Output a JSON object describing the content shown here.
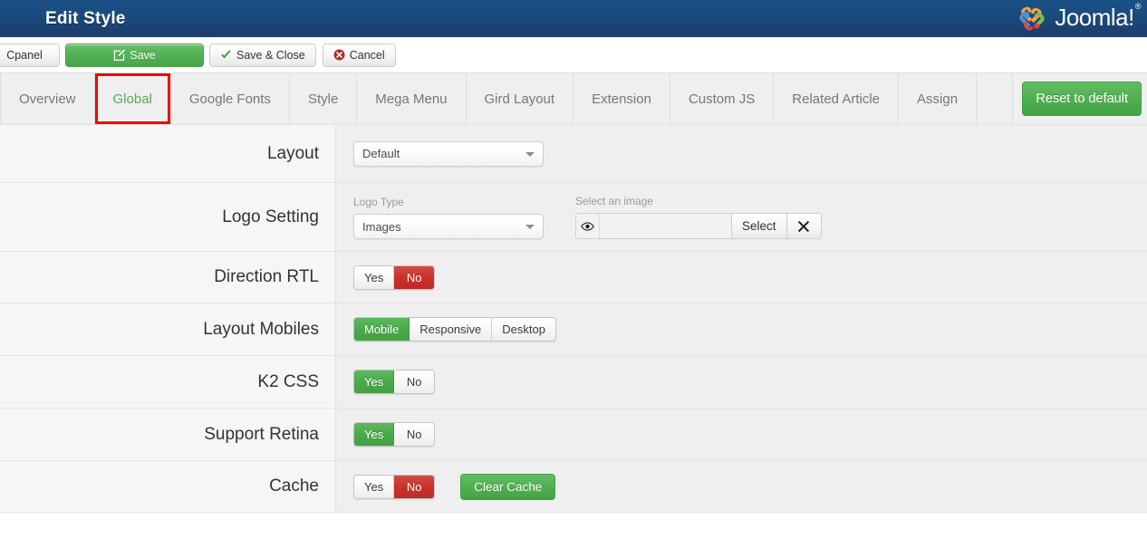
{
  "header": {
    "title": "Edit Style",
    "brand_name": "Joomla!",
    "brand_reg": "®",
    "brand_icon": "joomla-logo-icon"
  },
  "toolbar": {
    "cpanel_label": "Cpanel",
    "save_label": "Save",
    "save_icon": "pencil-icon",
    "save_close_label": "Save & Close",
    "save_close_icon": "check-icon",
    "cancel_label": "Cancel",
    "cancel_icon": "cancel-circle-icon"
  },
  "tabs": {
    "items": [
      {
        "label": "Overview",
        "active": false
      },
      {
        "label": "Global",
        "active": true
      },
      {
        "label": "Google Fonts",
        "active": false
      },
      {
        "label": "Style",
        "active": false
      },
      {
        "label": "Mega Menu",
        "active": false
      },
      {
        "label": "Gird Layout",
        "active": false
      },
      {
        "label": "Extension",
        "active": false
      },
      {
        "label": "Custom JS",
        "active": false
      },
      {
        "label": "Related Article",
        "active": false
      },
      {
        "label": "Assign",
        "active": false
      }
    ],
    "reset_label": "Reset to default",
    "active_highlight_color": "#f60000",
    "active_text_color": "#5aa95a"
  },
  "form": {
    "layout": {
      "label": "Layout",
      "select_value": "Default"
    },
    "logo_setting": {
      "label": "Logo Setting",
      "logo_type_label": "Logo Type",
      "logo_type_value": "Images",
      "select_image_label": "Select an image",
      "image_value": "",
      "image_placeholder": "",
      "eye_icon": "eye-icon",
      "select_button_label": "Select",
      "clear_icon": "close-x-icon"
    },
    "direction_rtl": {
      "label": "Direction RTL",
      "options": [
        "Yes",
        "No"
      ],
      "selected": "No"
    },
    "layout_mobiles": {
      "label": "Layout Mobiles",
      "options": [
        "Mobile",
        "Responsive",
        "Desktop"
      ],
      "selected": "Mobile"
    },
    "k2_css": {
      "label": "K2 CSS",
      "options": [
        "Yes",
        "No"
      ],
      "selected": "Yes"
    },
    "support_retina": {
      "label": "Support Retina",
      "options": [
        "Yes",
        "No"
      ],
      "selected": "Yes"
    },
    "cache": {
      "label": "Cache",
      "options": [
        "Yes",
        "No"
      ],
      "selected": "No",
      "clear_cache_label": "Clear Cache"
    }
  },
  "colors": {
    "header_blue_top": "#1b5186",
    "header_blue_bottom": "#1d3c6b",
    "green": "#4fae4f",
    "red": "#c9302c",
    "highlight_red": "#f60000"
  }
}
